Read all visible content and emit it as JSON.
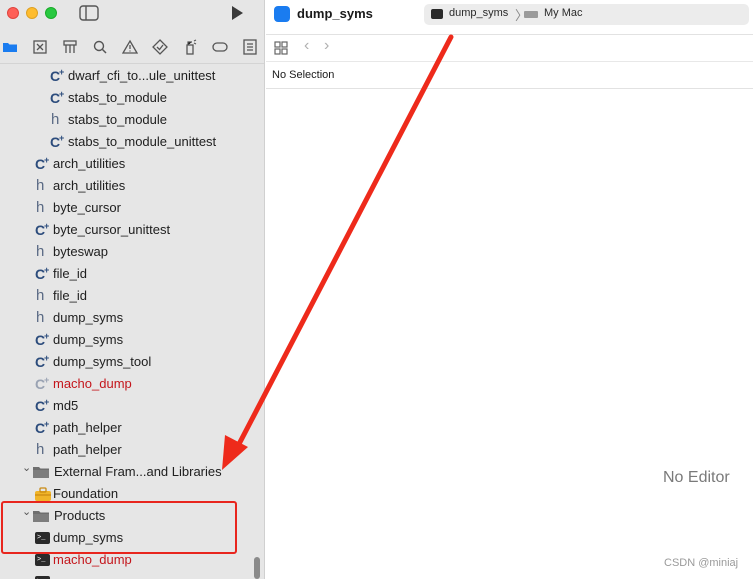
{
  "sidebar": {
    "nav_tabs": [
      "folder-icon",
      "x-square-icon",
      "hierarchy-icon",
      "search-icon",
      "warning-icon",
      "diamond-check-icon",
      "spray-icon",
      "tag-icon",
      "list-icon"
    ],
    "files": [
      {
        "label": "dwarf_cfi_to...ule_unittest",
        "kind": "cpp",
        "indent": 2,
        "missing": false
      },
      {
        "label": "stabs_to_module",
        "kind": "cpp",
        "indent": 2,
        "missing": false
      },
      {
        "label": "stabs_to_module",
        "kind": "header",
        "indent": 2,
        "missing": false
      },
      {
        "label": "stabs_to_module_unittest",
        "kind": "cpp",
        "indent": 2,
        "missing": false
      },
      {
        "label": "arch_utilities",
        "kind": "cpp",
        "indent": 1,
        "missing": false
      },
      {
        "label": "arch_utilities",
        "kind": "header",
        "indent": 1,
        "missing": false
      },
      {
        "label": "byte_cursor",
        "kind": "header",
        "indent": 1,
        "missing": false
      },
      {
        "label": "byte_cursor_unittest",
        "kind": "cpp",
        "indent": 1,
        "missing": false
      },
      {
        "label": "byteswap",
        "kind": "header",
        "indent": 1,
        "missing": false
      },
      {
        "label": "file_id",
        "kind": "cpp",
        "indent": 1,
        "missing": false
      },
      {
        "label": "file_id",
        "kind": "header",
        "indent": 1,
        "missing": false
      },
      {
        "label": "dump_syms",
        "kind": "header",
        "indent": 1,
        "missing": false
      },
      {
        "label": "dump_syms",
        "kind": "cpp",
        "indent": 1,
        "missing": false
      },
      {
        "label": "dump_syms_tool",
        "kind": "cpp",
        "indent": 1,
        "missing": false
      },
      {
        "label": "macho_dump",
        "kind": "cpp",
        "indent": 1,
        "missing": true
      },
      {
        "label": "md5",
        "kind": "cpp",
        "indent": 1,
        "missing": false
      },
      {
        "label": "path_helper",
        "kind": "cpp",
        "indent": 1,
        "missing": false
      },
      {
        "label": "path_helper",
        "kind": "header",
        "indent": 1,
        "missing": false
      },
      {
        "label": "External Fram...and Libraries",
        "kind": "group",
        "indent": 0,
        "missing": false
      },
      {
        "label": "Foundation",
        "kind": "toolbox",
        "indent": 1,
        "missing": false
      },
      {
        "label": "Products",
        "kind": "group",
        "indent": 0,
        "missing": false
      },
      {
        "label": "dump_syms",
        "kind": "terminal",
        "indent": 1,
        "missing": false
      },
      {
        "label": "macho_dump",
        "kind": "terminal",
        "indent": 1,
        "missing": true
      },
      {
        "label": "",
        "kind": "terminal",
        "indent": 1,
        "missing": true
      }
    ]
  },
  "main": {
    "project_title": "dump_syms",
    "scheme_name": "dump_syms",
    "run_destination": "My Mac",
    "no_selection": "No Selection",
    "no_editor": "No Editor"
  },
  "watermark": "CSDN @miniaj",
  "colors": {
    "annotation_red": "#e8261e",
    "missing_file_red": "#c4161c",
    "accent_blue": "#1a7cf0"
  }
}
